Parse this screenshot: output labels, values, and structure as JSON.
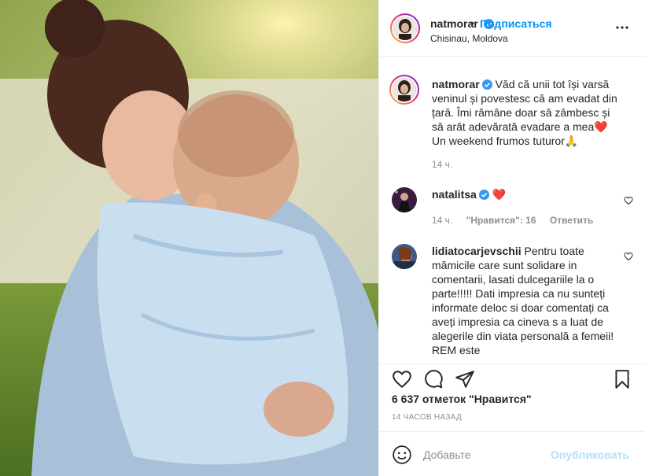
{
  "post": {
    "username": "natmorar",
    "location": "Chisinau, Moldova",
    "follow_label": "Подписаться",
    "separator": "•"
  },
  "caption": {
    "username": "natmorar",
    "text": "Văd că unii tot își varsă veninul și povestesc că am evadat din țară. Îmi rămâne doar să zâmbesc și să arăt adevărată evadare a mea❤️Un weekend frumos tuturor🙏",
    "time": "14 ч."
  },
  "comments": [
    {
      "username": "natalitsa",
      "text": "❤️",
      "time": "14 ч.",
      "likes_label": "\"Нравится\": 16",
      "reply_label": "Ответить"
    },
    {
      "username": "lidiatocarjevschii",
      "text": "Pentru toate mămicile care sunt solidare in comentarii, lasati dulcegariile la o parte!!!!! Dati impresia ca nu sunteți informate deloc si doar comentați ca aveți impresia ca cineva s a luat de alegerile din viata personală a femeii! REM este"
    }
  ],
  "stats": {
    "likes": "6 637 отметок \"Нравится\"",
    "posted": "14 ЧАСОВ НАЗАД"
  },
  "add_comment": {
    "placeholder": "Добавьте",
    "publish_label": "Опубликовать"
  },
  "colors": {
    "accent": "#0095f6",
    "publish_disabled": "#b2dffc",
    "verified": "#3897f0",
    "heart": "#ed4956"
  },
  "icons": [
    "verified-icon",
    "more-options-icon",
    "heart-icon",
    "comment-icon",
    "share-icon",
    "bookmark-icon",
    "emoji-icon"
  ]
}
